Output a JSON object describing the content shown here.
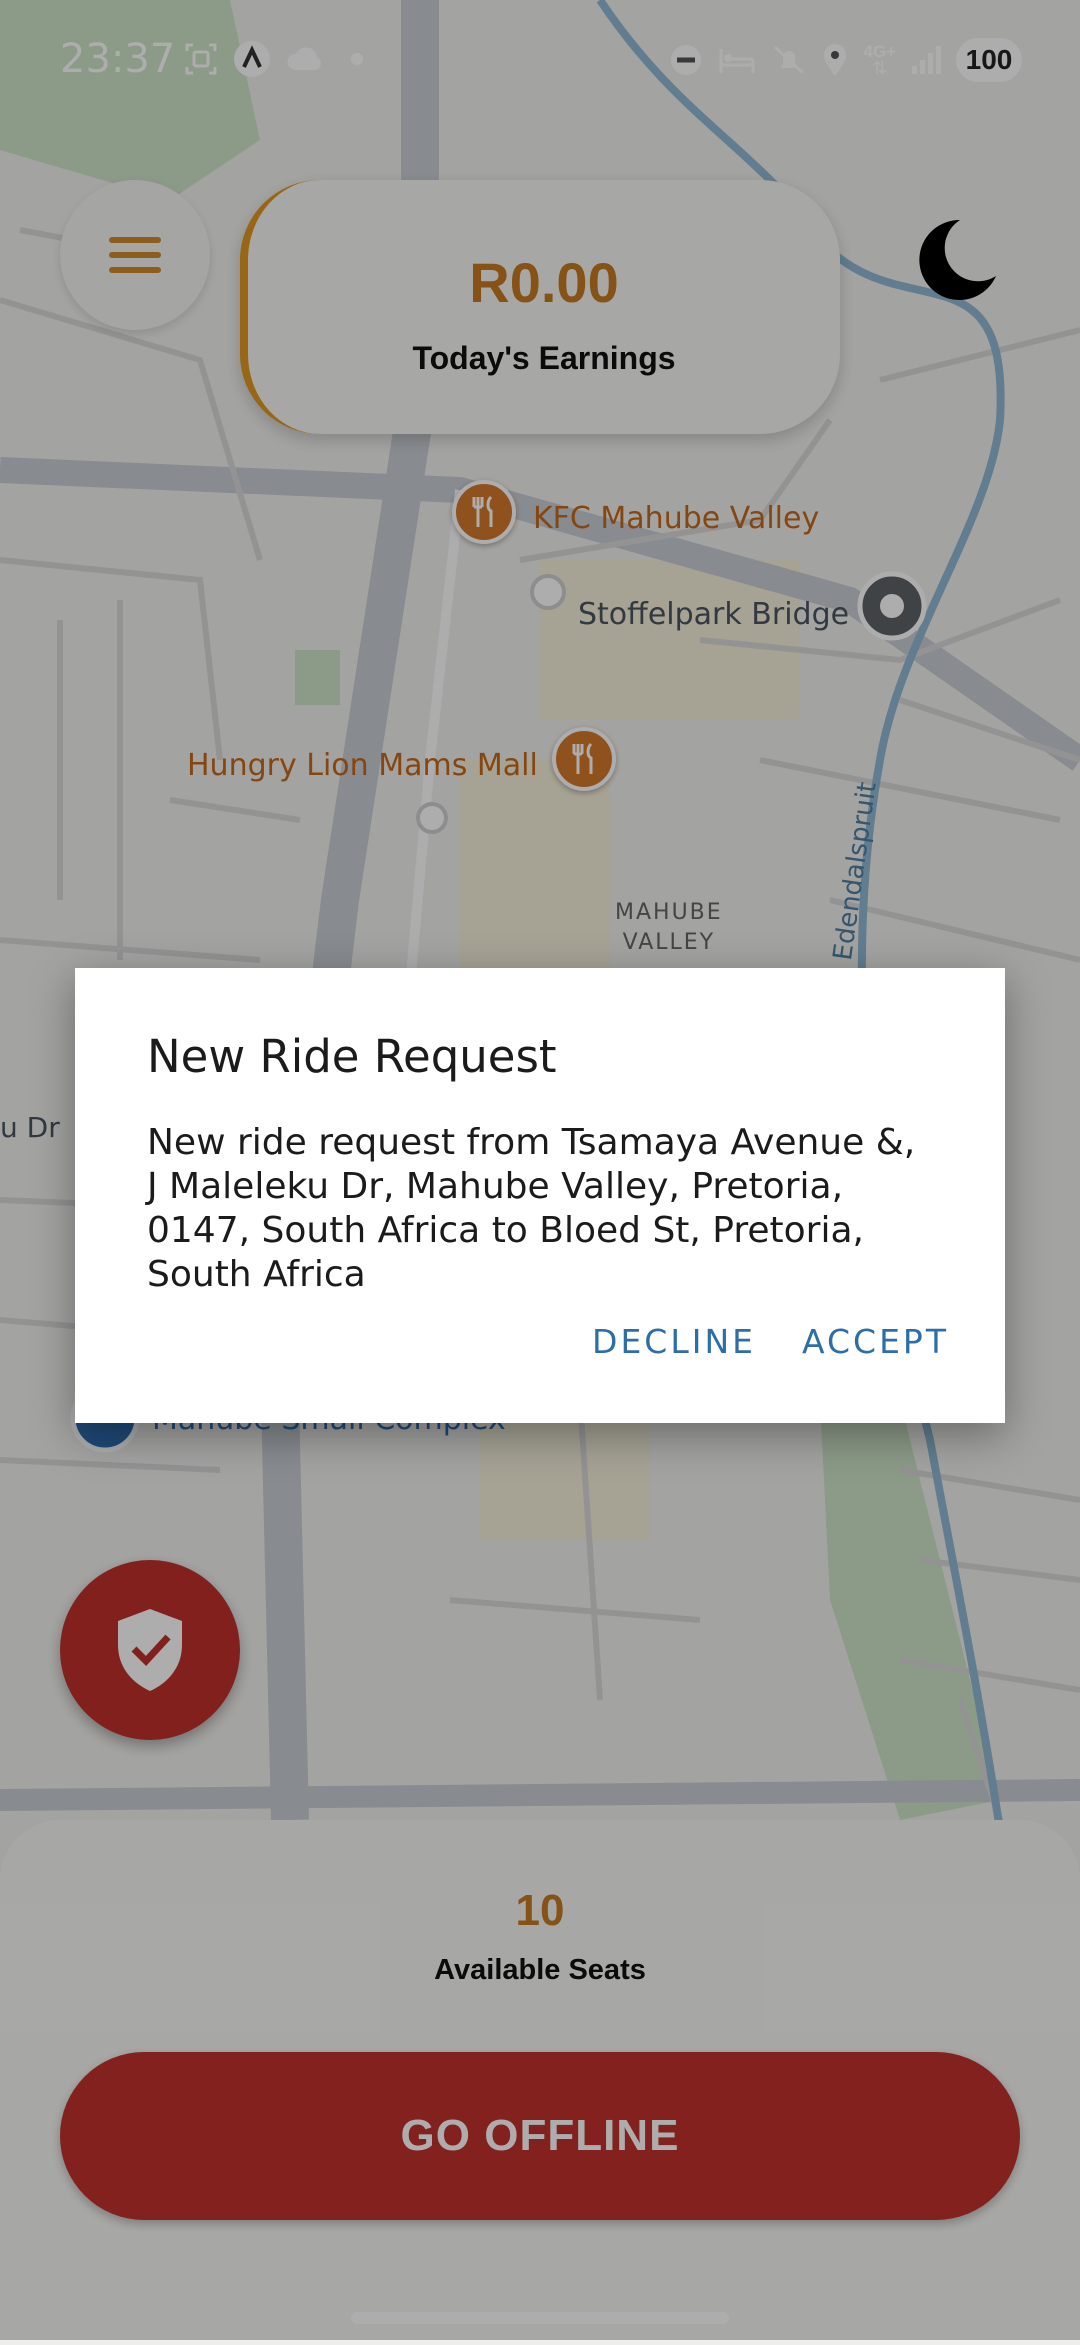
{
  "status_bar": {
    "time": "23:37",
    "icons_left": [
      "screenshot-icon",
      "app-icon",
      "cloud-icon",
      "notification-dot-icon"
    ],
    "icons_right": [
      "dnd-icon",
      "sleep-icon",
      "mute-icon",
      "location-icon",
      "network-4g-icon",
      "signal-icon"
    ],
    "network_label": "4G+",
    "battery": "100"
  },
  "header": {
    "earnings_amount": "R0.00",
    "earnings_label": "Today's Earnings"
  },
  "map": {
    "places": {
      "kfc": "KFC Mahube Valley",
      "stoffelpark": "Stoffelpark Bridge",
      "hungry_lion": "Hungry Lion Mams Mall",
      "area_line1": "MAHUBE",
      "area_line2": "VALLEY",
      "river": "Edendalspruit",
      "street_fragment": "u Dr",
      "complex": "Mahube Small Complex"
    }
  },
  "dialog": {
    "title": "New Ride Request",
    "message": "New ride request from Tsamaya Avenue &, J Maleleku Dr, Mahube Valley, Pretoria, 0147, South Africa to Bloed St, Pretoria, South Africa",
    "decline_label": "DECLINE",
    "accept_label": "ACCEPT"
  },
  "bottom_sheet": {
    "seats_value": "10",
    "seats_label": "Available Seats",
    "go_offline_label": "GO OFFLINE"
  },
  "colors": {
    "accent": "#e0971f",
    "danger": "#c0302b",
    "dialog_button": "#2e6ea8"
  }
}
